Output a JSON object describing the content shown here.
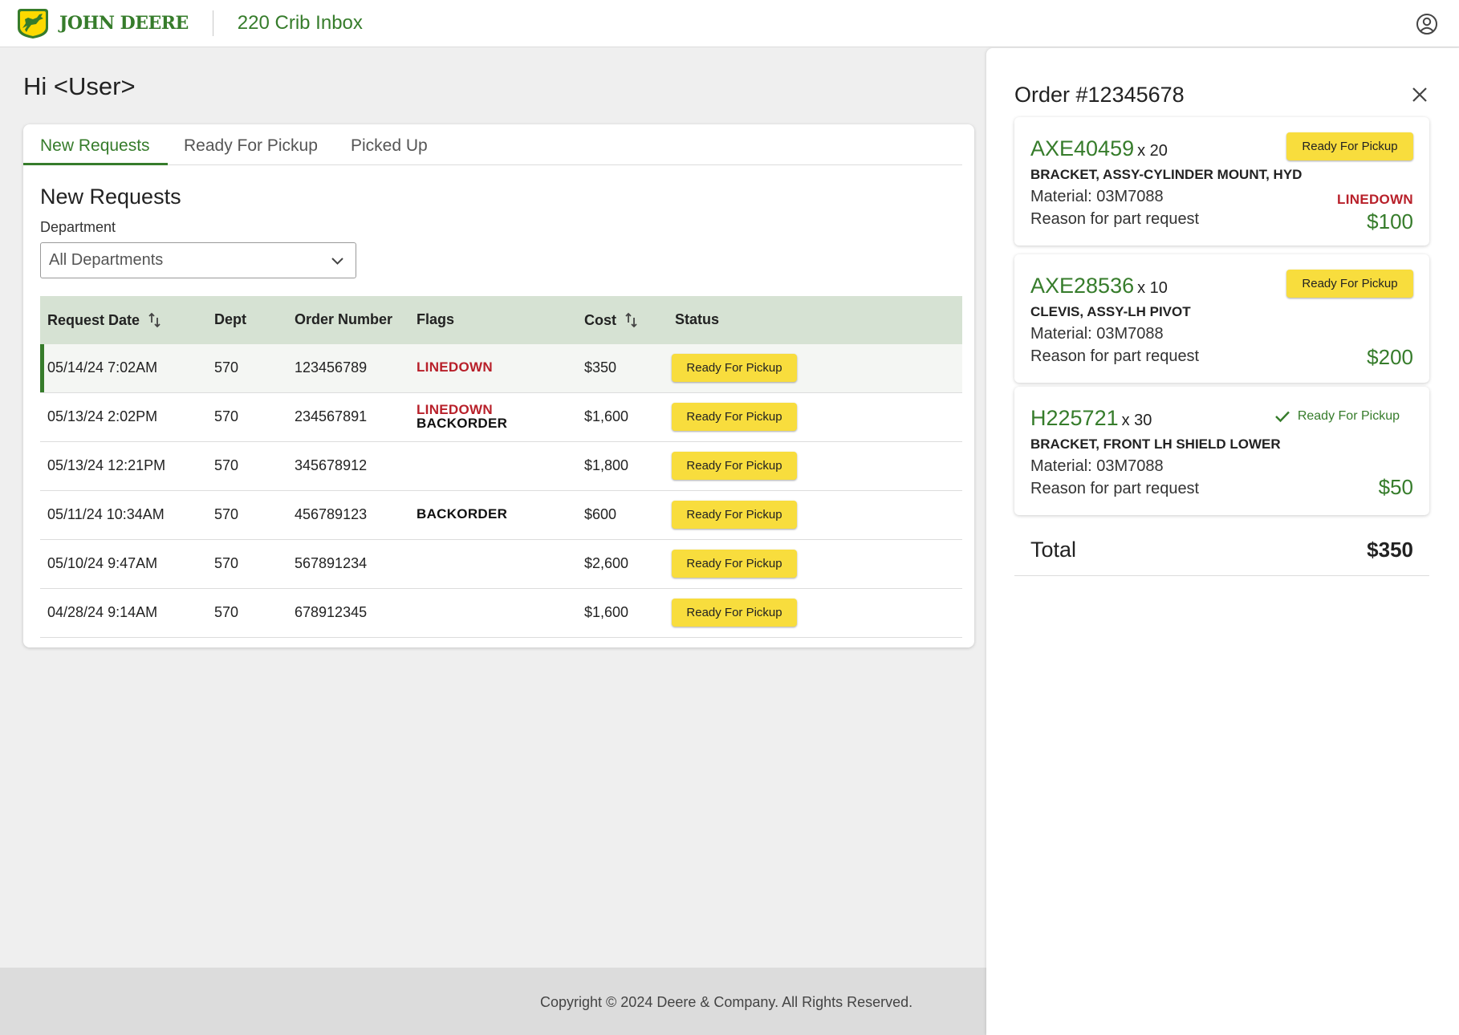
{
  "header": {
    "brand": "JOHN DEERE",
    "app_title": "220 Crib Inbox",
    "account_icon": "user-circle-icon"
  },
  "greeting": "Hi <User>",
  "tabs": [
    {
      "label": "New Requests",
      "active": true
    },
    {
      "label": "Ready For Pickup",
      "active": false
    },
    {
      "label": "Picked Up",
      "active": false
    }
  ],
  "section_title": "New Requests",
  "filter": {
    "label": "Department",
    "value": "All Departments"
  },
  "table": {
    "columns": [
      "Request Date",
      "Dept",
      "Order Number",
      "Flags",
      "Cost",
      "Status"
    ],
    "rows": [
      {
        "date": "05/14/24 7:02AM",
        "dept": "570",
        "order": "123456789",
        "flags": [
          "LINEDOWN"
        ],
        "cost": "$350",
        "status": "Ready For Pickup",
        "selected": true
      },
      {
        "date": "05/13/24 2:02PM",
        "dept": "570",
        "order": "234567891",
        "flags": [
          "LINEDOWN",
          "BACKORDER"
        ],
        "cost": "$1,600",
        "status": "Ready For Pickup",
        "selected": false
      },
      {
        "date": "05/13/24 12:21PM",
        "dept": "570",
        "order": "345678912",
        "flags": [],
        "cost": "$1,800",
        "status": "Ready For Pickup",
        "selected": false
      },
      {
        "date": "05/11/24 10:34AM",
        "dept": "570",
        "order": "456789123",
        "flags": [
          "BACKORDER"
        ],
        "cost": "$600",
        "status": "Ready For Pickup",
        "selected": false
      },
      {
        "date": "05/10/24 9:47AM",
        "dept": "570",
        "order": "567891234",
        "flags": [],
        "cost": "$2,600",
        "status": "Ready For Pickup",
        "selected": false
      },
      {
        "date": "04/28/24 9:14AM",
        "dept": "570",
        "order": "678912345",
        "flags": [],
        "cost": "$1,600",
        "status": "Ready For Pickup",
        "selected": false
      }
    ]
  },
  "footer": {
    "copyright": "Copyright © 2024 Deere & Company. All Rights Reserved."
  },
  "order_panel": {
    "title": "Order #12345678",
    "items": [
      {
        "part": "AXE40459",
        "qty": "x 20",
        "description": "BRACKET, ASSY-CYLINDER MOUNT, HYD",
        "material": "Material: 03M7088",
        "reason": "Reason for part request",
        "status": "Ready For Pickup",
        "status_done": false,
        "flag": "LINEDOWN",
        "price": "$100"
      },
      {
        "part": "AXE28536",
        "qty": "x 10",
        "description": "CLEVIS, ASSY-LH PIVOT",
        "material": "Material: 03M7088",
        "reason": "Reason for part request",
        "status": "Ready For Pickup",
        "status_done": false,
        "flag": "",
        "price": "$200"
      },
      {
        "part": "H225721",
        "qty": "x 30",
        "description": "BRACKET, FRONT LH SHIELD LOWER",
        "material": "Material: 03M7088",
        "reason": "Reason for part request",
        "status": "Ready For Pickup",
        "status_done": true,
        "flag": "",
        "price": "$50"
      }
    ],
    "total_label": "Total",
    "total_value": "$350"
  },
  "colors": {
    "brand_green": "#367c2b",
    "brand_yellow": "#f8dd3d",
    "flag_red": "#b8202a",
    "table_header_bg": "#d6e2d3"
  }
}
